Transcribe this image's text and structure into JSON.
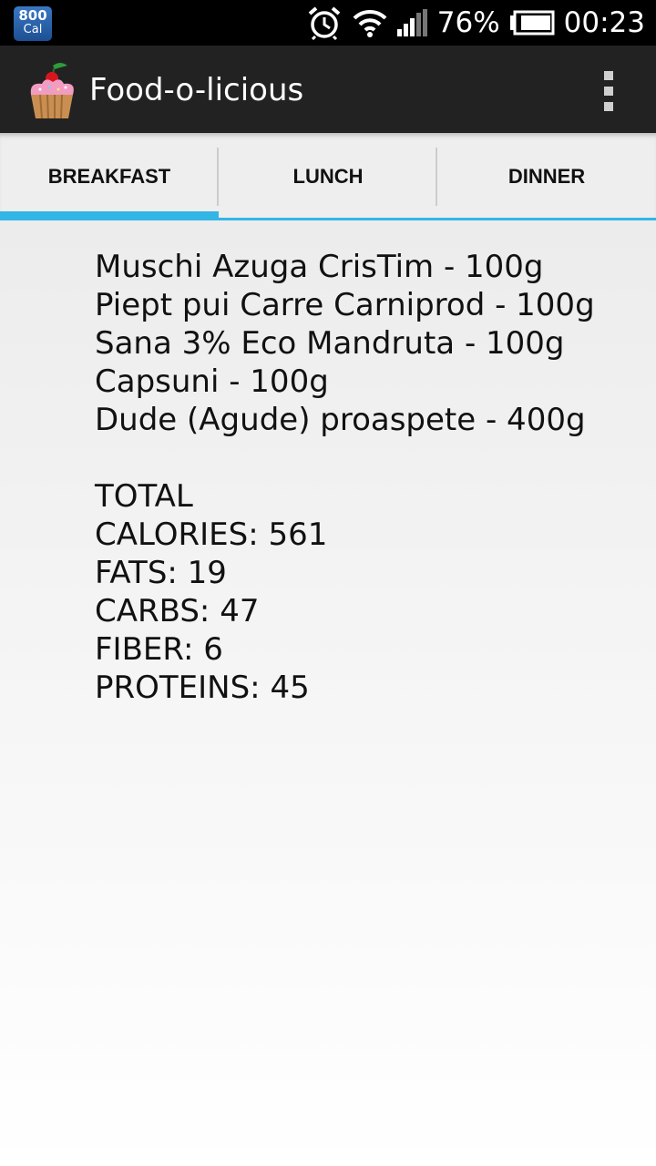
{
  "status_bar": {
    "cal_badge_number": "800",
    "cal_badge_unit": "Cal",
    "battery": "76%",
    "time": "00:23"
  },
  "action_bar": {
    "title": "Food-o-licious"
  },
  "tabs": [
    {
      "label": "BREAKFAST",
      "active": true
    },
    {
      "label": "LUNCH",
      "active": false
    },
    {
      "label": "DINNER",
      "active": false
    }
  ],
  "meal": {
    "items": [
      "Muschi Azuga CrisTim - 100g",
      "Piept pui Carre Carniprod - 100g",
      "Sana 3% Eco Mandruta - 100g",
      "Capsuni - 100g",
      "Dude (Agude) proaspete - 400g"
    ],
    "total_heading": "TOTAL",
    "totals": [
      "CALORIES: 561",
      "FATS: 19",
      "CARBS: 47",
      "FIBER: 6",
      "PROTEINS: 45"
    ]
  },
  "colors": {
    "accent": "#33b5e5",
    "action_bar": "#222222",
    "status_bar": "#000000"
  }
}
